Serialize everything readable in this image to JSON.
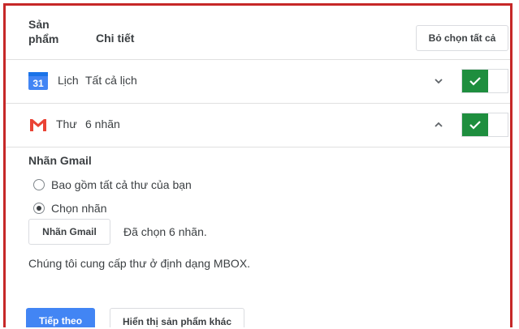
{
  "header": {
    "product_label": "Sản phẩm",
    "detail_label": "Chi tiết",
    "deselect_all": "Bỏ chọn tất cả"
  },
  "products": [
    {
      "name": "Lịch",
      "detail": "Tất cả lịch",
      "icon": "google-calendar-icon",
      "calendar_day": "31",
      "expanded": false,
      "enabled": true
    },
    {
      "name": "Thư",
      "detail": "6 nhãn",
      "icon": "gmail-icon",
      "expanded": true,
      "enabled": true
    }
  ],
  "gmail_options": {
    "title": "Nhãn Gmail",
    "radio_all": "Bao gồm tất cả thư của bạn",
    "radio_select": "Chọn nhãn",
    "selected_option": "radio_select",
    "labels_button": "Nhãn Gmail",
    "selected_count_text": "Đã chọn 6 nhãn.",
    "format_text": "Chúng tôi cung cấp thư ở định dạng MBOX."
  },
  "footer": {
    "next_button": "Tiếp theo",
    "more_products_button": "Hiển thị sản phẩm khác"
  },
  "colors": {
    "toggle_on": "#1e8e3e",
    "primary_button": "#4285f4",
    "frame_border": "#c62828"
  }
}
